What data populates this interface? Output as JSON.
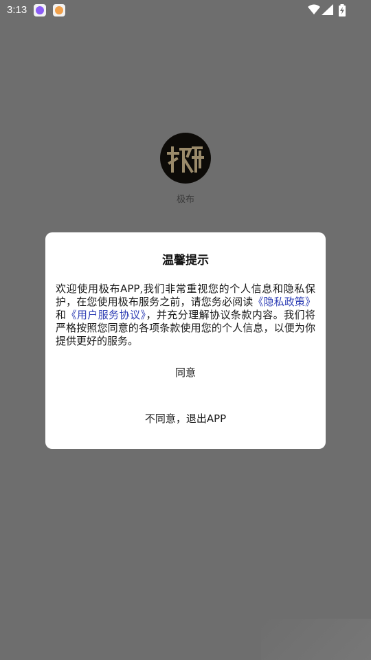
{
  "status_bar": {
    "time": "3:13",
    "icons": [
      "app-notification-icon",
      "app-notification-icon",
      "wifi-icon",
      "signal-icon",
      "battery-charging-icon"
    ]
  },
  "splash": {
    "app_name": "极布"
  },
  "dialog": {
    "title": "温馨提示",
    "body_part1": "欢迎使用极布APP,我们非常重视您的个人信息和隐私保护，在您使用极布服务之前，请您务必阅读",
    "privacy_link": "《隐私政策》",
    "body_part2": "和",
    "agreement_link": "《用户服务协议》",
    "body_part3": "，并充分理解协议条款内容。我们将严格按照您同意的各项条款使用您的个人信息，以便为你提供更好的服务。",
    "agree_label": "同意",
    "disagree_label": "不同意，退出APP"
  },
  "colors": {
    "overlay": "#6e6e6e",
    "link": "#2f3fb5",
    "dialog_bg": "#ffffff"
  }
}
